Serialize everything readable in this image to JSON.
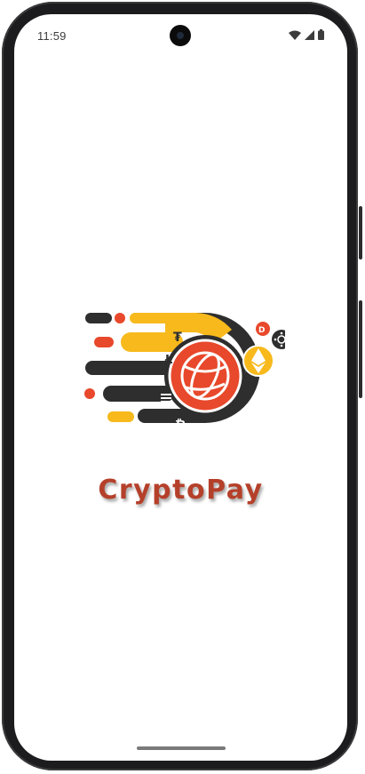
{
  "status_bar": {
    "time": "11:59",
    "icons": [
      "wifi-icon",
      "cell-signal-icon",
      "battery-icon"
    ]
  },
  "app": {
    "brand_name": "CryptoPay"
  },
  "logo": {
    "coins": [
      "tether-icon",
      "litecoin-icon",
      "bitcoin-icon",
      "ethereum-icon",
      "dash-icon",
      "cardano-icon",
      "globe-icon",
      "stellar-icon"
    ]
  },
  "colors": {
    "brand_text": "#b5402a",
    "accent_orange": "#e8482b",
    "accent_yellow": "#f7b91c",
    "dark": "#2e2e2e"
  }
}
